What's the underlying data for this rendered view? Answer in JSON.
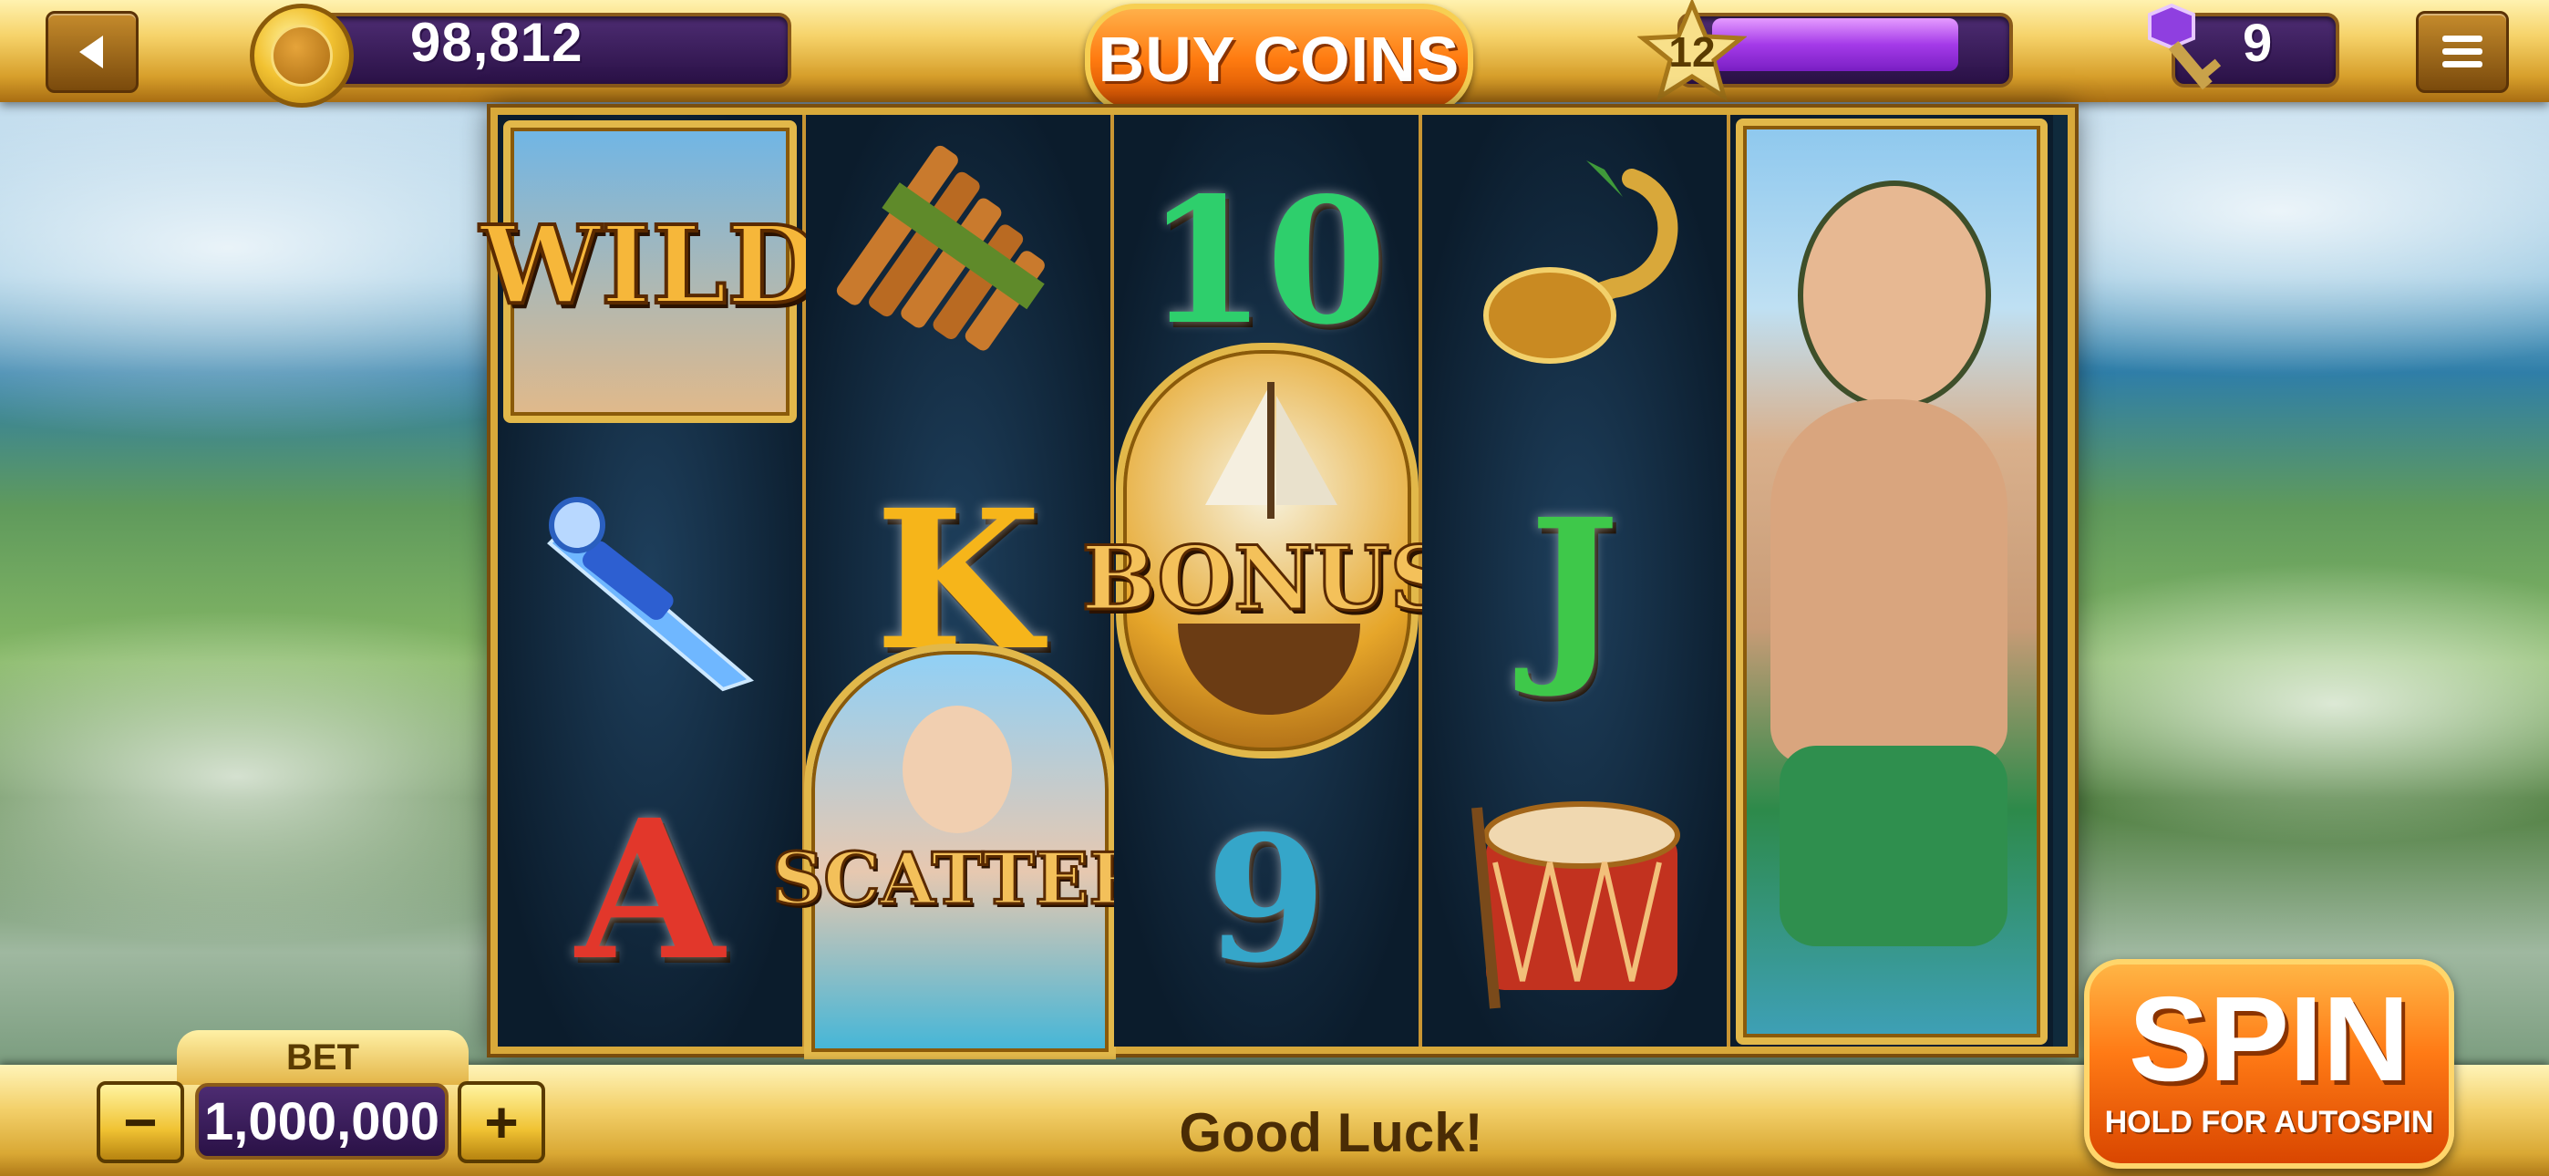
{
  "header": {
    "back_icon": "back-arrow-icon",
    "coin_balance": "98,812",
    "buy_coins_label": "BUY COINS",
    "level": "12",
    "xp_progress": 0.9,
    "keys": "9",
    "menu_icon": "hamburger-menu-icon"
  },
  "reels": {
    "reel1": [
      "WILD",
      "dagger",
      "A"
    ],
    "reel2": [
      "pan-flute",
      "K",
      "SCATTER"
    ],
    "reel3": [
      "10",
      "BONUS",
      "9"
    ],
    "reel4": [
      "hook",
      "J",
      "drum"
    ],
    "reel5": [
      "character-expanded"
    ]
  },
  "bet": {
    "label": "BET",
    "value": "1,000,000",
    "minus": "−",
    "plus": "+"
  },
  "status": "Good Luck!",
  "spin": {
    "label": "SPIN",
    "sub_label": "HOLD FOR AUTOSPIN"
  },
  "colors": {
    "gold": "#f6d36a",
    "purple": "#2a1146",
    "orange": "#ff7b10"
  }
}
